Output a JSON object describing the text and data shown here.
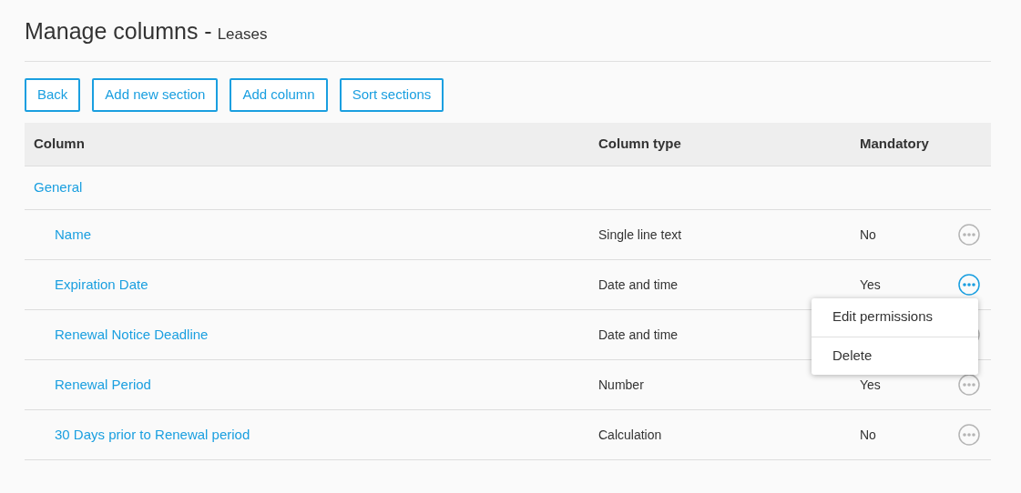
{
  "title": {
    "main": "Manage columns -",
    "subtitle": "Leases"
  },
  "buttons": [
    "Back",
    "Add new section",
    "Add column",
    "Sort sections"
  ],
  "table": {
    "columns": [
      "Column",
      "Column type",
      "Mandatory"
    ],
    "rows": [
      {
        "kind": "section",
        "name": "General"
      },
      {
        "kind": "column",
        "name": "Name",
        "type": "Single line text",
        "mandatory": "No",
        "menu_open": false
      },
      {
        "kind": "column",
        "name": "Expiration Date",
        "type": "Date and time",
        "mandatory": "Yes",
        "menu_open": true
      },
      {
        "kind": "column",
        "name": "Renewal Notice Deadline",
        "type": "Date and time",
        "menu_open": false
      },
      {
        "kind": "column",
        "name": "Renewal Period",
        "type": "Number",
        "mandatory": "Yes",
        "menu_open": false
      },
      {
        "kind": "column",
        "name": "30 Days prior to Renewal period",
        "type": "Calculation",
        "mandatory": "No",
        "menu_open": false
      }
    ]
  },
  "context_menu": [
    "Edit permissions",
    "Delete"
  ]
}
